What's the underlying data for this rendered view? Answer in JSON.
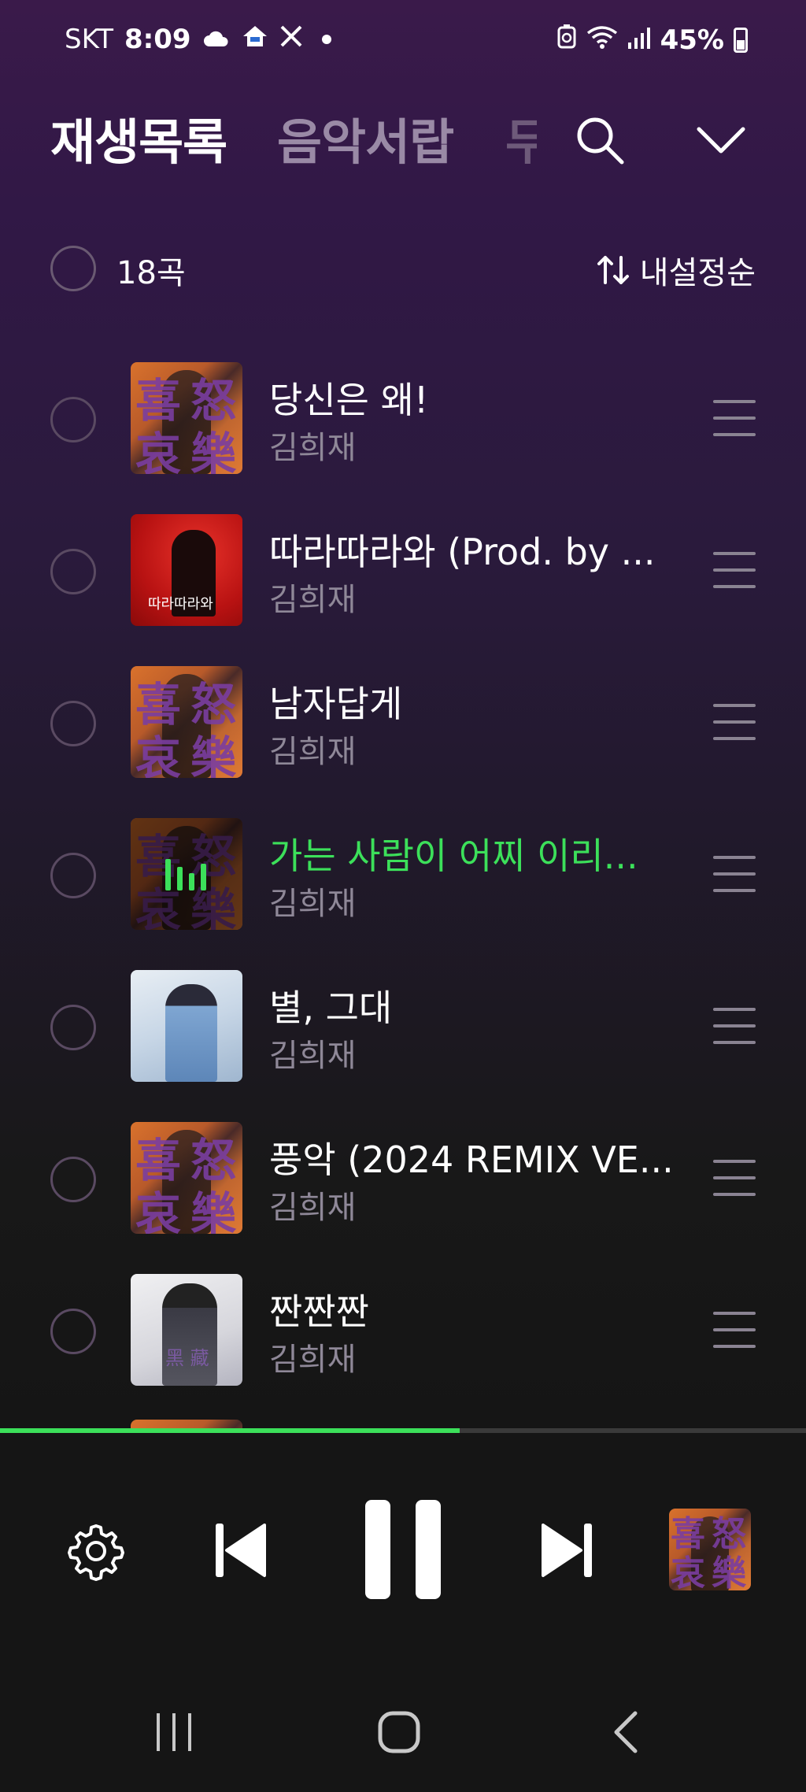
{
  "status_bar": {
    "carrier": "SKT",
    "time": "8:09",
    "battery": "45%",
    "icons": [
      "cloud-icon",
      "home-icon",
      "x-icon",
      "dot-icon",
      "battery-saver-icon",
      "wifi-icon",
      "signal-icon",
      "battery-icon"
    ]
  },
  "header": {
    "tabs": [
      {
        "label": "재생목록",
        "active": true
      },
      {
        "label": "음악서랍",
        "active": false
      },
      {
        "label": "무",
        "active": false
      }
    ],
    "icons": [
      "search-icon",
      "chevron-down-icon"
    ]
  },
  "toolbar": {
    "count": "18곡",
    "sort_label": "내설정순",
    "sort_icon": "sort-arrows-icon"
  },
  "tracks": [
    {
      "title": "당신은 왜!",
      "artist": "김희재",
      "art": "orange",
      "playing": false
    },
    {
      "title": "따라따라와 (Prod. by ...",
      "artist": "김희재",
      "art": "red",
      "playing": false
    },
    {
      "title": "남자답게",
      "artist": "김희재",
      "art": "orange",
      "playing": false
    },
    {
      "title": "가는 사람이 어찌 이리...",
      "artist": "김희재",
      "art": "orange",
      "playing": true
    },
    {
      "title": "별, 그대",
      "artist": "김희재",
      "art": "blue",
      "playing": false
    },
    {
      "title": "풍악 (2024 REMIX VE...",
      "artist": "김희재",
      "art": "orange",
      "playing": false
    },
    {
      "title": "짠짠짠",
      "artist": "김희재",
      "art": "grey",
      "playing": false
    }
  ],
  "player": {
    "progress": 0.57,
    "icons": [
      "settings-icon",
      "previous-icon",
      "pause-icon",
      "next-icon"
    ]
  },
  "colors": {
    "accent_green": "#3ce05a",
    "bg_top": "#3a1a4a",
    "bg_bottom": "#121212"
  }
}
